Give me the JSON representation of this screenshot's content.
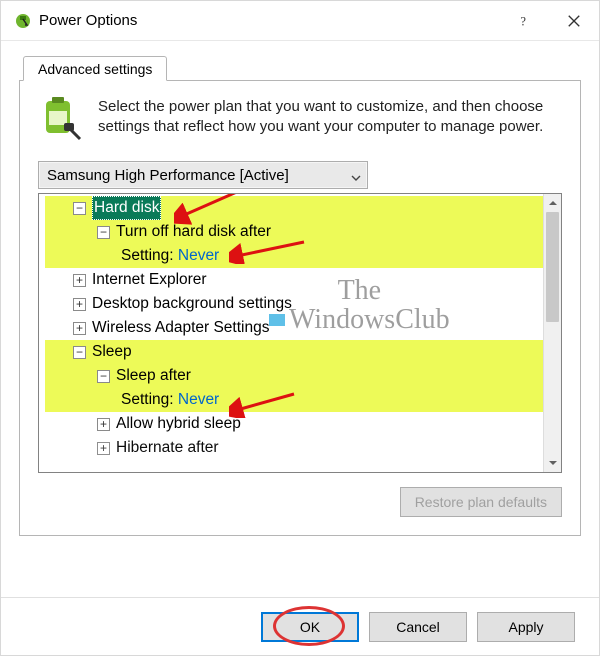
{
  "window": {
    "title": "Power Options",
    "help_icon": "help-icon",
    "close_icon": "close-icon"
  },
  "tab": {
    "label": "Advanced settings"
  },
  "intro": {
    "text": "Select the power plan that you want to customize, and then choose settings that reflect how you want your computer to manage power."
  },
  "plan_dropdown": {
    "selected": "Samsung High Performance [Active]"
  },
  "tree": {
    "hard_disk": {
      "label": "Hard disk",
      "expanded": true,
      "child": {
        "label": "Turn off hard disk after",
        "expanded": true,
        "setting_label": "Setting:",
        "setting_value": "Never"
      }
    },
    "ie": {
      "label": "Internet Explorer",
      "expanded": false
    },
    "desktop": {
      "label": "Desktop background settings",
      "expanded": false
    },
    "wifi": {
      "label": "Wireless Adapter Settings",
      "expanded": false
    },
    "sleep": {
      "label": "Sleep",
      "expanded": true,
      "children": {
        "sleep_after": {
          "label": "Sleep after",
          "expanded": true,
          "setting_label": "Setting:",
          "setting_value": "Never"
        },
        "hybrid": {
          "label": "Allow hybrid sleep",
          "expanded": false
        },
        "hibernate": {
          "label": "Hibernate after",
          "expanded": false
        }
      }
    }
  },
  "buttons": {
    "restore": "Restore plan defaults",
    "ok": "OK",
    "cancel": "Cancel",
    "apply": "Apply"
  },
  "watermark": {
    "line1": "The",
    "line2": "WindowsClub"
  }
}
